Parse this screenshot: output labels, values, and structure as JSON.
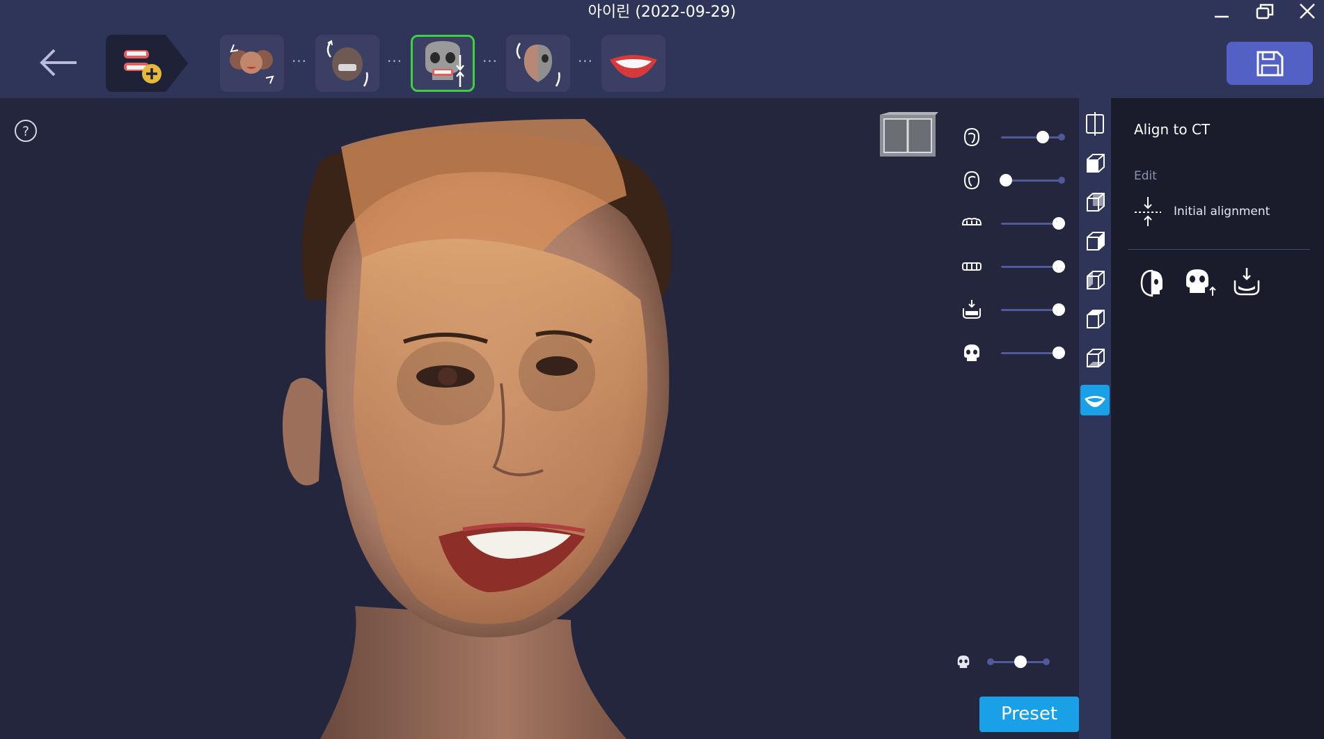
{
  "window": {
    "title": "아이린 (2022-09-29)"
  },
  "workflow": {
    "steps": [
      {
        "name": "add-scan",
        "icon": "dentition-add-icon"
      },
      {
        "name": "face-align",
        "icon": "face-align-icon"
      },
      {
        "name": "head-align",
        "icon": "head-align-icon"
      },
      {
        "name": "align-to-ct",
        "icon": "skull-align-icon",
        "active": true
      },
      {
        "name": "face-ct-merge",
        "icon": "face-skull-merge-icon"
      },
      {
        "name": "smile-design",
        "icon": "smile-lips-icon"
      }
    ]
  },
  "visibility_sliders": [
    {
      "icon": "face-front-icon",
      "level": 0.7
    },
    {
      "icon": "face-back-icon",
      "level": 0.0
    },
    {
      "icon": "upper-teeth-icon",
      "level": 1.0
    },
    {
      "icon": "lower-teeth-icon",
      "level": 1.0
    },
    {
      "icon": "lower-jaw-icon",
      "level": 1.0
    },
    {
      "icon": "skull-icon",
      "level": 1.0
    }
  ],
  "ct_opacity_slider": {
    "icon": "skull-small-icon",
    "level": 0.5
  },
  "preset_label": "Preset",
  "view_toolbar": [
    {
      "icon": "split-view-icon"
    },
    {
      "icon": "view-front-cube-icon"
    },
    {
      "icon": "view-back-cube-icon"
    },
    {
      "icon": "view-left-cube-icon"
    },
    {
      "icon": "view-right-cube-icon"
    },
    {
      "icon": "view-top-cube-icon"
    },
    {
      "icon": "view-bottom-cube-icon"
    },
    {
      "icon": "lips-icon",
      "active": true
    }
  ],
  "panel": {
    "title": "Align to CT",
    "section_label": "Edit",
    "initial_alignment_label": "Initial alignment",
    "tools": [
      {
        "icon": "face-skull-icon"
      },
      {
        "icon": "skull-move-icon"
      },
      {
        "icon": "jaw-align-icon"
      }
    ]
  },
  "colors": {
    "topbar": "#2f3558",
    "viewport": "#23263d",
    "panel": "#1a1c2b",
    "accent": "#1aa0e6",
    "active_step": "#3dd23d",
    "save_button": "#5361c4"
  }
}
